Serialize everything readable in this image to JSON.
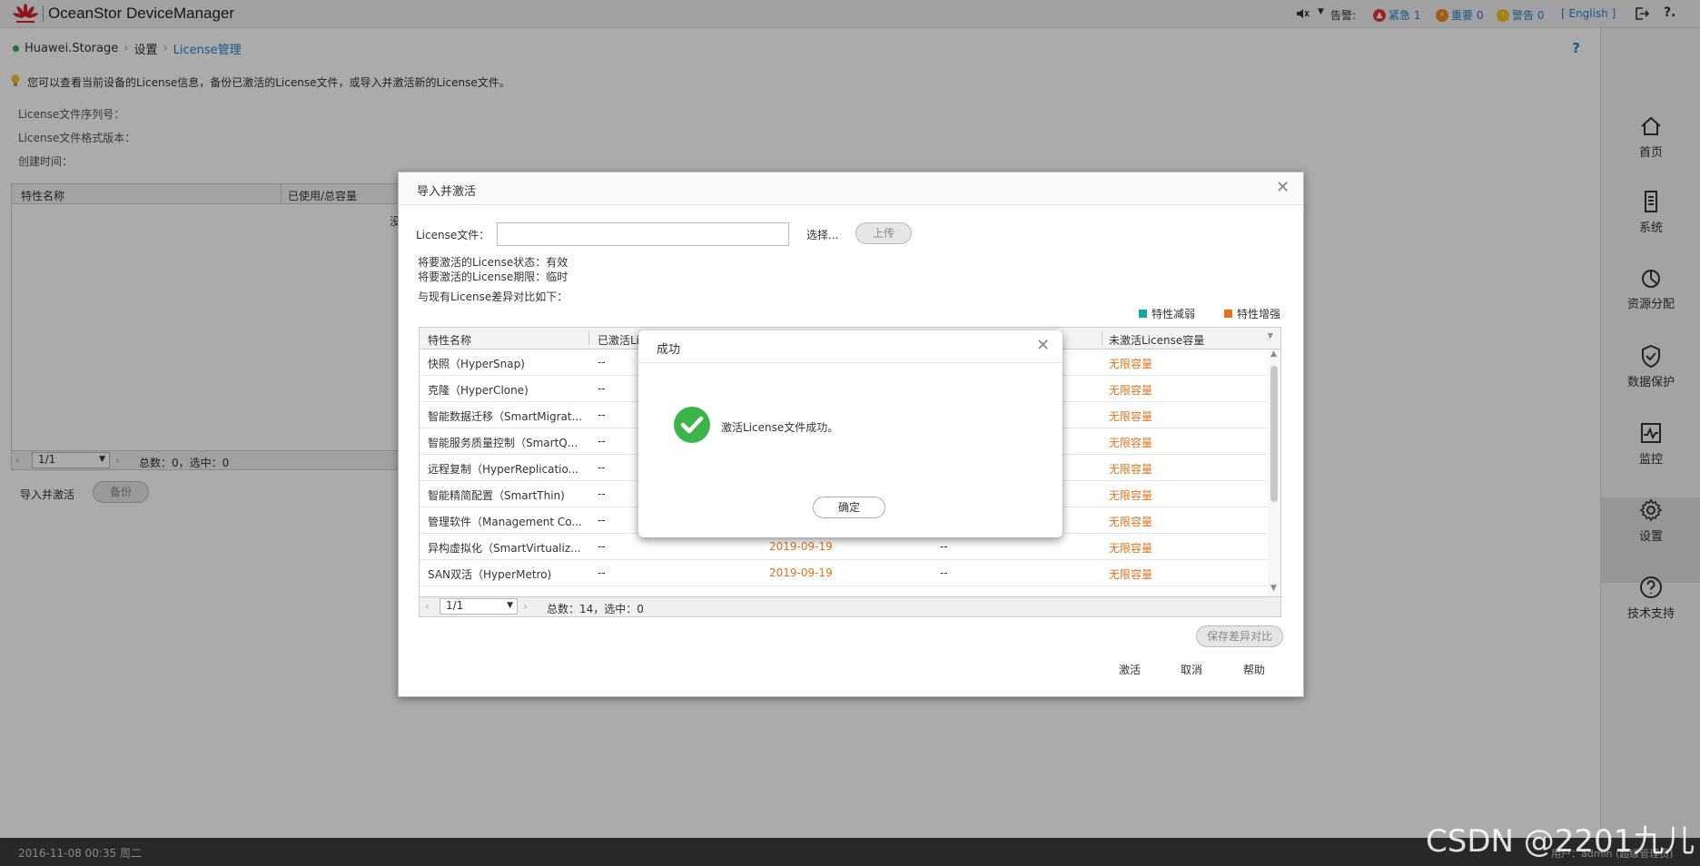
{
  "header": {
    "app_title": "OceanStor DeviceManager",
    "alarm_label": "告警:",
    "alarms": [
      {
        "label": "紧急 1",
        "color": "#e03a3a"
      },
      {
        "label": "重要 0",
        "color": "#f08a1c"
      },
      {
        "label": "警告 0",
        "color": "#f2c318"
      }
    ],
    "language": "[ English ]"
  },
  "breadcrumb": {
    "items": [
      "Huawei.Storage",
      "设置",
      "License管理"
    ],
    "help": "?"
  },
  "tip": "您可以查看当前设备的License信息，备份已激活的License文件，或导入并激活新的License文件。",
  "info": {
    "serial": "License文件序列号：",
    "format_version": "License文件格式版本：",
    "created": "创建时间："
  },
  "left_table": {
    "headers": [
      "特性名称",
      "已使用/总容量"
    ],
    "empty_text": "没",
    "pager": "1/1",
    "summary": "总数：0，选中：0"
  },
  "left_actions": {
    "import": "导入并激活",
    "backup": "备份"
  },
  "sidebar": {
    "items": [
      {
        "label": "首页",
        "icon": "home-icon"
      },
      {
        "label": "系统",
        "icon": "system-icon"
      },
      {
        "label": "资源分配",
        "icon": "resource-icon"
      },
      {
        "label": "数据保护",
        "icon": "shield-icon"
      },
      {
        "label": "监控",
        "icon": "monitor-icon"
      },
      {
        "label": "设置",
        "icon": "gear-icon"
      },
      {
        "label": "技术支持",
        "icon": "support-icon"
      }
    ],
    "selected": "设置"
  },
  "status_bar": {
    "datetime": "2016-11-08 00:35 周二",
    "user": "用户：admin (超级管理员)"
  },
  "import_dialog": {
    "title": "导入并激活",
    "file_label": "License文件：",
    "select": "选择...",
    "upload": "上传",
    "state": "将要激活的License状态：有效",
    "term": "将要激活的License期限：临时",
    "compare": "与现有License差异对比如下：",
    "legend": [
      {
        "label": "特性减弱",
        "color": "#1aa3a3"
      },
      {
        "label": "特性增强",
        "color": "#e0751d"
      }
    ],
    "table": {
      "headers": [
        "特性名称",
        "已激活Li",
        "未激活License容量"
      ],
      "rows": [
        {
          "name": "快照（HyperSnap)",
          "active": "--",
          "date": "",
          "cap": "--",
          "inactive": "无限容量"
        },
        {
          "name": "克隆（HyperClone)",
          "active": "--",
          "date": "",
          "cap": "--",
          "inactive": "无限容量"
        },
        {
          "name": "智能数据迁移（SmartMigrat...",
          "active": "--",
          "date": "",
          "cap": "--",
          "inactive": "无限容量"
        },
        {
          "name": "智能服务质量控制（SmartQ...",
          "active": "--",
          "date": "",
          "cap": "--",
          "inactive": "无限容量"
        },
        {
          "name": "远程复制（HyperReplicatio...",
          "active": "--",
          "date": "",
          "cap": "--",
          "inactive": "无限容量"
        },
        {
          "name": "智能精简配置（SmartThin)",
          "active": "--",
          "date": "",
          "cap": "--",
          "inactive": "无限容量"
        },
        {
          "name": "管理软件（Management Co...",
          "active": "--",
          "date": "",
          "cap": "--",
          "inactive": "无限容量"
        },
        {
          "name": "异构虚拟化（SmartVirtualiz...",
          "active": "--",
          "date": "2019-09-19",
          "cap": "--",
          "inactive": "无限容量"
        },
        {
          "name": "SAN双活（HyperMetro)",
          "active": "--",
          "date": "2019-09-19",
          "cap": "--",
          "inactive": "无限容量"
        }
      ],
      "pager": "1/1",
      "summary": "总数：14，选中：0"
    },
    "save_diff": "保存差异对比",
    "buttons": {
      "activate": "激活",
      "cancel": "取消",
      "help": "帮助"
    }
  },
  "success_dialog": {
    "title": "成功",
    "message": "激活License文件成功。",
    "ok": "确定"
  },
  "watermark": "CSDN @2201九儿"
}
